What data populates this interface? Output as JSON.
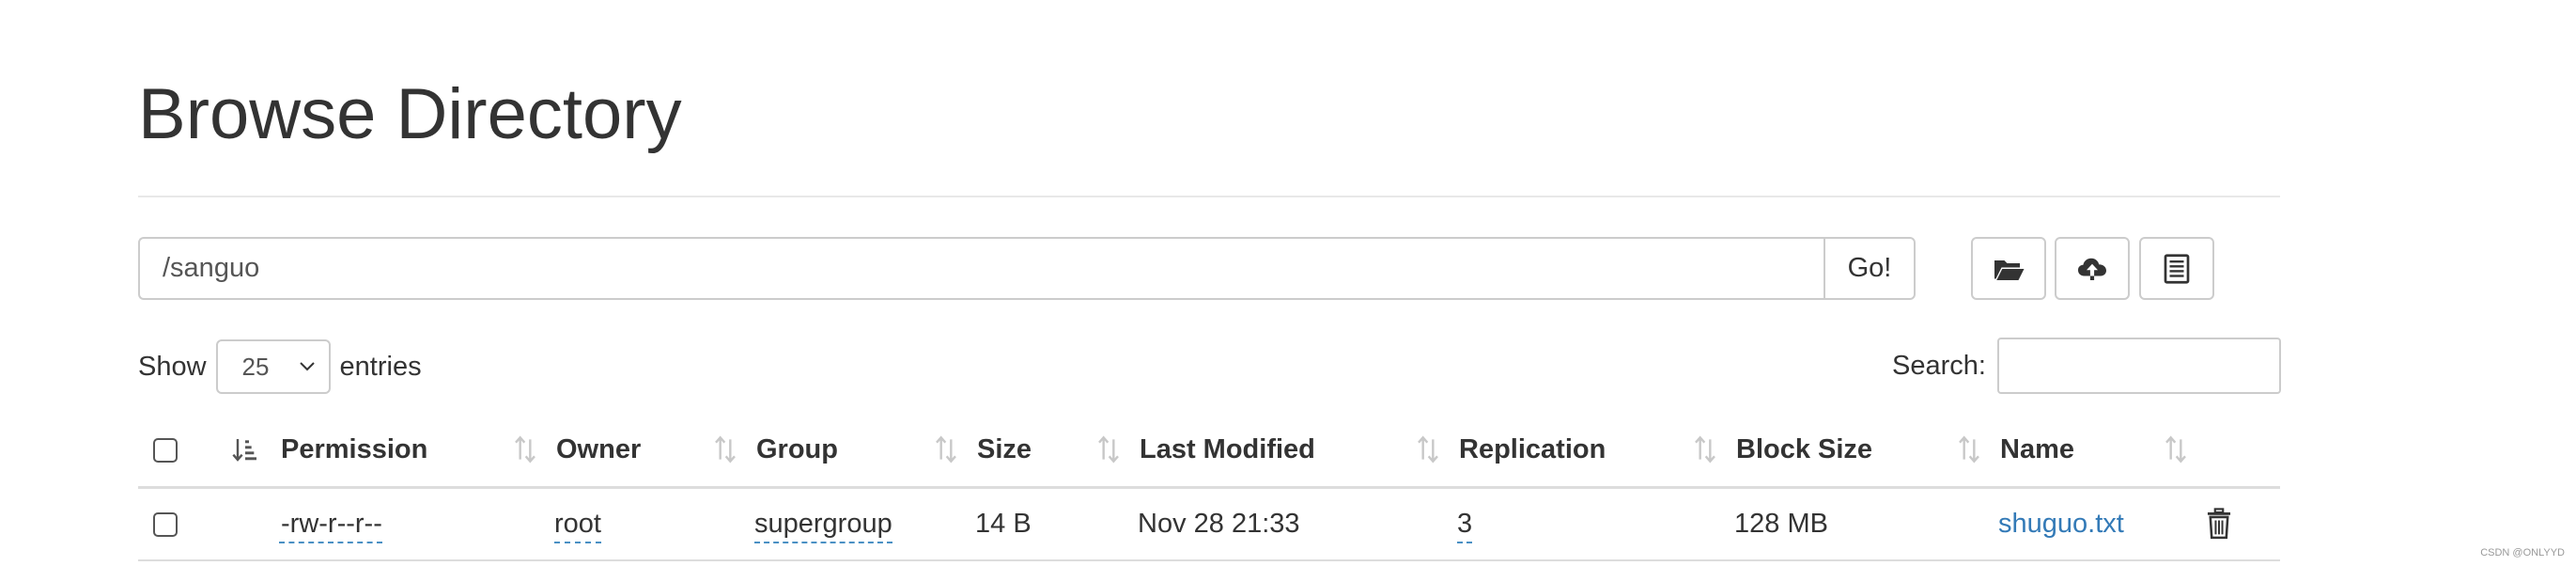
{
  "page": {
    "title": "Browse Directory"
  },
  "path_bar": {
    "value": "/sanguo",
    "go_label": "Go!"
  },
  "toolbar": {
    "icons": [
      "folder-open-icon",
      "cloud-upload-icon",
      "clipboard-list-icon"
    ]
  },
  "length_control": {
    "show_label": "Show",
    "selected": "25",
    "entries_label": "entries"
  },
  "search": {
    "label": "Search:",
    "value": ""
  },
  "table": {
    "columns": [
      "Permission",
      "Owner",
      "Group",
      "Size",
      "Last Modified",
      "Replication",
      "Block Size",
      "Name"
    ],
    "rows": [
      {
        "permission": "-rw-r--r--",
        "owner": "root",
        "group": "supergroup",
        "size": "14 B",
        "last_modified": "Nov 28 21:33",
        "replication": "3",
        "block_size": "128 MB",
        "name": "shuguo.txt"
      }
    ]
  },
  "watermark": "CSDN @ONLYYD",
  "colors": {
    "link": "#337ab7",
    "border": "#cccccc",
    "text": "#333333"
  }
}
